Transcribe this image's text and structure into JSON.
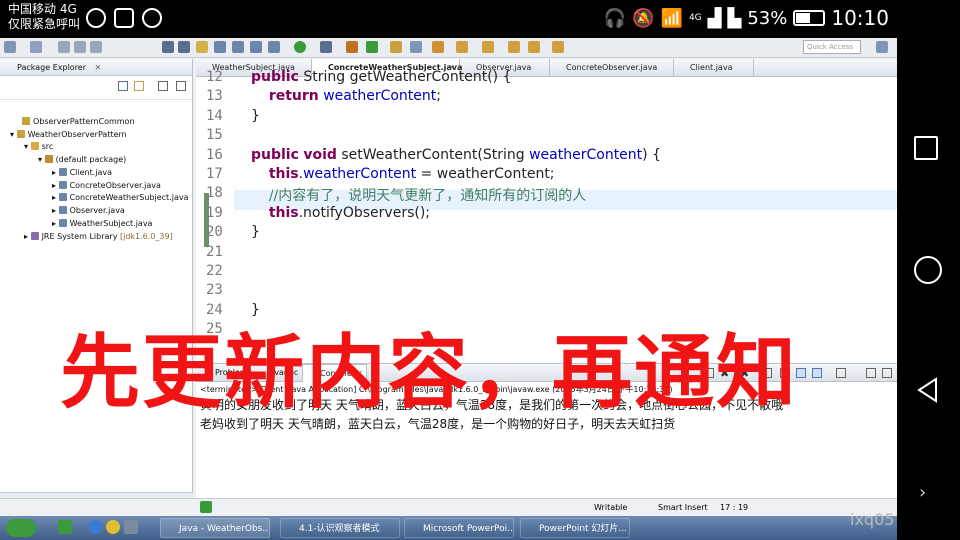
{
  "phone_status": {
    "carrier": "中国移动 4G",
    "emergency": "仅限紧急呼叫",
    "net": "4G",
    "battery": "53%",
    "time": "10:10"
  },
  "ide": {
    "quick_access_placeholder": "Quick Access",
    "package_explorer": {
      "title": "Package Explorer",
      "items": [
        {
          "label": "ObserverPatternCommon"
        },
        {
          "label": "WeatherObserverPattern"
        },
        {
          "label": "src"
        },
        {
          "label": "(default package)"
        },
        {
          "label": "Client.java"
        },
        {
          "label": "ConcreteObserver.java"
        },
        {
          "label": "ConcreteWeatherSubject.java"
        },
        {
          "label": "Observer.java"
        },
        {
          "label": "WeatherSubject.java"
        },
        {
          "label": "JRE System Library",
          "suffix": "[jdk1.6.0_39]"
        }
      ]
    },
    "editor_tabs": [
      {
        "label": "WeatherSubject.java"
      },
      {
        "label": "ConcreteWeatherSubject.java"
      },
      {
        "label": "Observer.java"
      },
      {
        "label": "ConcreteObserver.java"
      },
      {
        "label": "Client.java"
      }
    ],
    "code_lines": [
      {
        "no": "12",
        "parts": [
          [
            "kw",
            "public"
          ],
          [
            "t",
            " String getWeatherContent() {"
          ]
        ]
      },
      {
        "no": "13",
        "parts": [
          [
            "t",
            "    "
          ],
          [
            "kw",
            "return"
          ],
          [
            "t",
            " "
          ],
          [
            "fld",
            "weatherContent"
          ],
          [
            "t",
            ";"
          ]
        ]
      },
      {
        "no": "14",
        "parts": [
          [
            "t",
            "}"
          ]
        ]
      },
      {
        "no": "15",
        "parts": []
      },
      {
        "no": "16",
        "parts": [
          [
            "kw",
            "public"
          ],
          [
            "t",
            " "
          ],
          [
            "kw",
            "void"
          ],
          [
            "t",
            " setWeatherContent(String "
          ],
          [
            "fld",
            "weatherContent"
          ],
          [
            "t",
            ") {"
          ]
        ]
      },
      {
        "no": "17",
        "parts": [
          [
            "t",
            "    "
          ],
          [
            "kw",
            "this"
          ],
          [
            "t",
            "."
          ],
          [
            "fld",
            "weatherContent"
          ],
          [
            "t",
            " = weatherContent;"
          ]
        ]
      },
      {
        "no": "18",
        "parts": [
          [
            "t",
            "    "
          ],
          [
            "cm",
            "//内容有了，说明天气更新了，通知所有的订阅的人"
          ]
        ]
      },
      {
        "no": "19",
        "parts": [
          [
            "t",
            "    "
          ],
          [
            "kw",
            "this"
          ],
          [
            "t",
            ".notifyObservers();"
          ]
        ]
      },
      {
        "no": "20",
        "parts": [
          [
            "t",
            "}"
          ]
        ]
      },
      {
        "no": "21",
        "parts": []
      },
      {
        "no": "22",
        "parts": []
      },
      {
        "no": "23",
        "parts": []
      },
      {
        "no": "24",
        "parts": [
          [
            "t",
            "}"
          ]
        ]
      },
      {
        "no": "25",
        "parts": []
      }
    ],
    "overlay_text": "先更新内容，再通知",
    "console_tabs": [
      {
        "label": "Problems"
      },
      {
        "label": "Javadoc"
      },
      {
        "label": "Console"
      }
    ],
    "console_terminated": "<terminated> Client [Java Application] C:\\Program Files\\Java\\jdk1.6.0_39\\bin\\javaw.exe (2015年3月24日 下午10:29:36)",
    "console_output": [
      "黄明的女朋友收到了明天 天气晴朗，蓝天白云，气温28度，是我们的第一次约会，地点街心公园，不见不散哦",
      "老妈收到了明天 天气晴朗，蓝天白云，气温28度，是一个购物的好日子，明天去天虹扫货"
    ],
    "status_bar": {
      "writable": "Writable",
      "insert_mode": "Smart Insert",
      "position": "17 : 19"
    }
  },
  "taskbar": {
    "items": [
      {
        "label": "Java - WeatherObs..."
      },
      {
        "label": "4.1-认识观察者模式"
      },
      {
        "label": "Microsoft PowerPoi..."
      },
      {
        "label": "PowerPoint 幻灯片..."
      }
    ],
    "watermark": "ixq05"
  },
  "colors": {
    "overlay": "#f01414",
    "keyword": "#7f0055",
    "field": "#0000c0",
    "comment": "#3f7f5f"
  }
}
